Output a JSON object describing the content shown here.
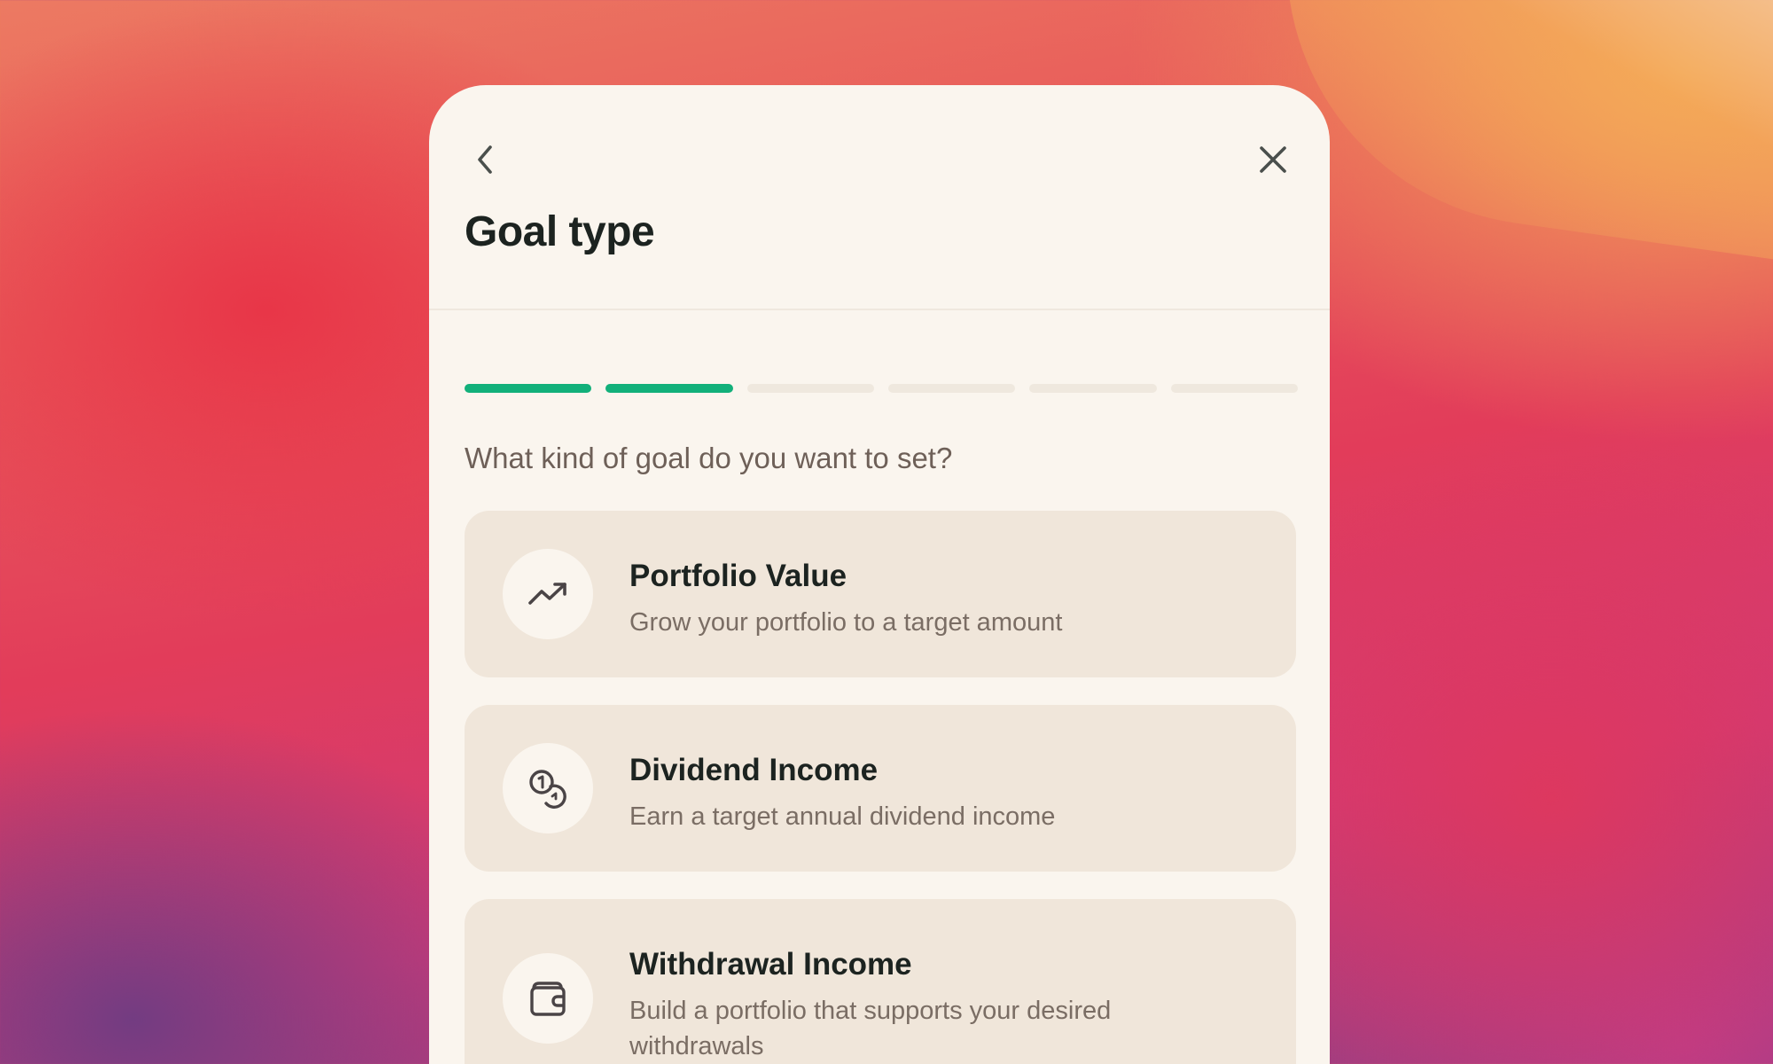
{
  "header": {
    "title": "Goal type",
    "back_icon": "chevron-left-icon",
    "close_icon": "close-icon"
  },
  "progress": {
    "total_steps": 6,
    "completed_steps": 2,
    "active_color": "#12b07a",
    "inactive_color": "#efe8de"
  },
  "question": "What kind of goal do you want to set?",
  "options": [
    {
      "title": "Portfolio Value",
      "description": "Grow your portfolio to a target amount",
      "icon": "trending-up-icon"
    },
    {
      "title": "Dividend Income",
      "description": "Earn a target annual dividend income",
      "icon": "coins-icon"
    },
    {
      "title": "Withdrawal Income",
      "description": "Build a portfolio that supports your desired withdrawals",
      "icon": "wallet-icon"
    }
  ]
}
